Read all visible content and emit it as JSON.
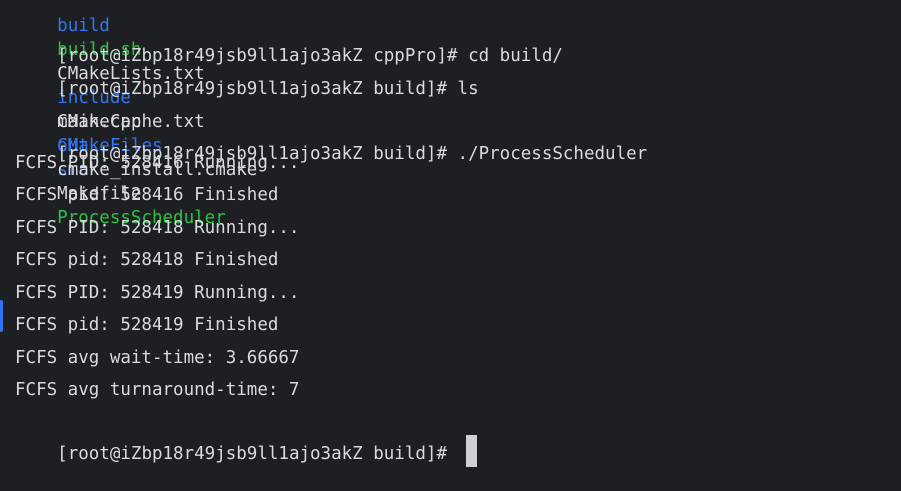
{
  "colors": {
    "background": "#1e1f22",
    "text": "#d8dade",
    "directory": "#3574f0",
    "executable": "#2bc241",
    "cursor": "#cfd1d6"
  },
  "top_listing": [
    {
      "text": "build",
      "kind": "directory"
    },
    {
      "text": "build.sh",
      "kind": "executable"
    },
    {
      "text": "CMakeLists.txt",
      "kind": "file"
    },
    {
      "text": "include",
      "kind": "directory"
    },
    {
      "text": "main.cpp",
      "kind": "file"
    },
    {
      "text": "out",
      "kind": "directory"
    },
    {
      "text": "src",
      "kind": "directory"
    }
  ],
  "lines": [
    {
      "prompt": "[root@iZbp18r49jsb9ll1ajo3akZ cppPro]# ",
      "command": "cd build/"
    },
    {
      "prompt": "[root@iZbp18r49jsb9ll1ajo3akZ build]# ",
      "command": "ls"
    }
  ],
  "ls_listing": [
    {
      "text": "CMakeCache.txt",
      "kind": "file"
    },
    {
      "text": "CMakeFiles",
      "kind": "directory"
    },
    {
      "text": "cmake_install.cmake",
      "kind": "file"
    },
    {
      "text": "Makefile",
      "kind": "file"
    },
    {
      "text": "ProcessScheduler",
      "kind": "executable"
    }
  ],
  "run_line": {
    "prompt": "[root@iZbp18r49jsb9ll1ajo3akZ build]# ",
    "command": "./ProcessScheduler"
  },
  "output": [
    "FCFS PID: 528416 Running...",
    "FCFS pid: 528416 Finished",
    "FCFS PID: 528418 Running...",
    "FCFS pid: 528418 Finished",
    "FCFS PID: 528419 Running...",
    "FCFS pid: 528419 Finished",
    "FCFS avg wait-time: 3.66667",
    "FCFS avg turnaround-time: 7"
  ],
  "final_prompt": "[root@iZbp18r49jsb9ll1ajo3akZ build]# "
}
